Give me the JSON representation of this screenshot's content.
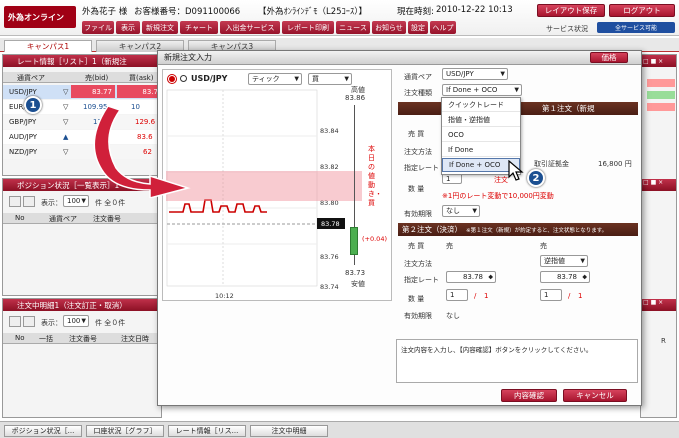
{
  "header": {
    "logo_text": "外為オンライン",
    "user_name": "外為花子 様",
    "customer_no": "お客様番号：D091100066",
    "account_type": "【外為ｵﾝﾗｲﾝﾃﾞﾓ（L25ｺｰｽ）】",
    "time_label": "現在時刻:",
    "time_value": "2010-12-22 10:13",
    "layout_save": "レイアウト保存",
    "logout": "ログアウト",
    "service_status_label": "サービス状況",
    "service_status_badge": "全サービス可能"
  },
  "menu": [
    "ファイル",
    "表示",
    "新規注文",
    "チャート",
    "入出金サービス",
    "レポート印刷",
    "ニュース",
    "お知らせ",
    "設定",
    "ヘルプ"
  ],
  "tabs": [
    "キャンパス1",
    "キャンパス2",
    "キャンパス3"
  ],
  "rate_panel": {
    "title": "レート情報［リスト］1（新規注",
    "col_pair": "通貨ペア",
    "col_bid": "売(bid)",
    "col_ask": "買(ask)",
    "rows": [
      {
        "pair": "USD/JPY",
        "bid": "83.77",
        "ask": "83.7"
      },
      {
        "pair": "EUR/JPY",
        "bid": "109.95",
        "ask": "10"
      },
      {
        "pair": "GBP/JPY",
        "bid": "129",
        "ask": "129.6"
      },
      {
        "pair": "AUD/JPY",
        "bid": "",
        "ask": "83.6"
      },
      {
        "pair": "NZD/JPY",
        "bid": "",
        "ask": "62"
      }
    ]
  },
  "position_panel": {
    "title": "ポジション状況［一覧表示］1",
    "display_label": "表示：",
    "display_count": "100",
    "count_suffix": "件 全０件",
    "col_no": "No",
    "col_pair": "通貨ペア",
    "col_order": "注文番号"
  },
  "order_panel": {
    "title": "注文中明細1（注文訂正・取消）",
    "display_label": "表示：",
    "display_count": "100",
    "count_suffix": "件 全０件",
    "col_no": "No",
    "col_batch": "一括",
    "col_order": "注文番号",
    "col_date": "注文日時"
  },
  "right_panel": {
    "title": "価格",
    "right_col_label": "R"
  },
  "modal": {
    "title": "新規注文入力",
    "chart": {
      "pair": "USD/JPY",
      "tick_select": "ティック",
      "side_select": "買",
      "high_label": "高値",
      "high_value": "83.86",
      "low_label": "安値",
      "low_value": "83.73",
      "y_ticks": [
        "83.84",
        "83.82",
        "83.80",
        "83.78",
        "83.76",
        "83.74"
      ],
      "current_price": "83.78",
      "x_tick": "10:12",
      "vertical_text": "本日の値動き・買",
      "vertical_change": "(+0.04)"
    },
    "form": {
      "pair_label": "通貨ペア",
      "pair_value": "USD/JPY",
      "type_label": "注文種類",
      "type_value": "If Done + OCO",
      "section1": "第１注文（新規",
      "sell_buy_label": "売 買",
      "method_label": "注文方法",
      "rate_label": "指定レート",
      "margin_label": "取引証拠金",
      "margin_value": "16,800 円",
      "qty_label": "数 量",
      "qty_value": "1",
      "qty_note": "注文",
      "unit_note": "※1円のレート変動で10,000円変動",
      "expiry_label": "有効期限",
      "expiry_value": "なし",
      "section2": "第２注文（決済）",
      "section2_note": "※第１注文（新規）が約定すると、注文状態となります。",
      "sell": "売",
      "buy": "売",
      "method_value": "逆指値",
      "rate1": "83.78",
      "rate2": "83.78",
      "qty1": "1",
      "qty2": "1",
      "slash": "/",
      "qty_denom": "1",
      "expiry2": "なし",
      "message": "注文内容を入力し、【内容確認】ボタンをクリックしてください。",
      "confirm": "内容確認",
      "cancel": "キャンセル",
      "close_btn": "価格"
    },
    "dropdown": [
      "クイックトレード",
      "指値・逆指値",
      "OCO",
      "If Done",
      "If Done + OCO"
    ]
  },
  "callouts": [
    "1",
    "2"
  ],
  "bottom_tabs": [
    "ポジション状況［...",
    "口座状況［グラフ］",
    "レート情報［リス...",
    "注文中明細"
  ],
  "colors": {
    "brand_red": "#a8152f",
    "rate_highlight": "#e84a5f",
    "callout_blue": "#1b4f91",
    "arrow_red": "#d0203a",
    "chart_band": "#f3b3b8"
  }
}
